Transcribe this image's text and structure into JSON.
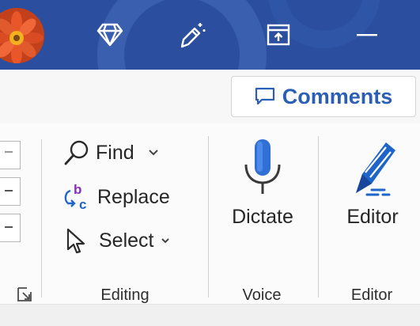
{
  "titlebar": {
    "icons": [
      "profile-avatar",
      "diamond-icon",
      "wand-icon",
      "ribbon-display-icon",
      "minimize-icon"
    ],
    "colors": {
      "background": "#2b4f9e",
      "icon": "#ffffff"
    }
  },
  "comments": {
    "label": "Comments",
    "icon": "comment-icon",
    "color": "#2b5fb5"
  },
  "editing": {
    "find_label": "Find",
    "replace_label": "Replace",
    "select_label": "Select",
    "group_label": "Editing"
  },
  "voice": {
    "dictate_label": "Dictate",
    "group_label": "Voice"
  },
  "editor": {
    "editor_label": "Editor",
    "group_label": "Editor"
  }
}
